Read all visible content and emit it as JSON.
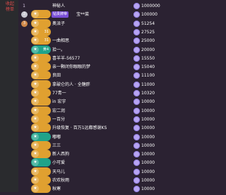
{
  "sidebar": {
    "tabs": [
      "收起",
      "榜单"
    ],
    "accent": "#e04b4b"
  },
  "rows": [
    {
      "rank": "1",
      "medal": "",
      "badge": "",
      "badge_color": "",
      "tag": "",
      "tag_color": "",
      "name": "神秘人",
      "score": "1000000"
    },
    {
      "rank": "",
      "medal": "2",
      "badge": "",
      "badge_color": "",
      "tag": "钻贵牌帝",
      "tag_color": "#7a4fd6",
      "name": "宝**菜",
      "score": "100000"
    },
    {
      "rank": "",
      "medal": "3",
      "badge": "",
      "badge_color": "",
      "tag": "",
      "tag_color": "",
      "name": "奥派子",
      "score": "51254"
    },
    {
      "rank": "",
      "medal": "",
      "badge": "31",
      "badge_color": "#e0a030",
      "tag": "",
      "tag_color": "",
      "name": "",
      "score": "27525"
    },
    {
      "rank": "",
      "medal": "",
      "badge": "31",
      "badge_color": "#e0a030",
      "tag": "",
      "tag_color": "",
      "name": "一曲相思",
      "score": "25000"
    },
    {
      "rank": "",
      "medal": "",
      "badge": "黄4",
      "badge_color": "#1fa38a",
      "tag": "",
      "tag_color": "",
      "name": "拾一。",
      "score": "20000"
    },
    {
      "rank": "",
      "medal": "",
      "badge": "",
      "badge_color": "#e0a030",
      "tag": "",
      "tag_color": "",
      "name": "喜羊羊-56577",
      "score": "15550"
    },
    {
      "rank": "",
      "medal": "",
      "badge": "",
      "badge_color": "#e0a030",
      "tag": "",
      "tag_color": "",
      "name": "亲一颗闭你眼眼的梦",
      "score": "15040"
    },
    {
      "rank": "",
      "medal": "",
      "badge": "",
      "badge_color": "#e0a030",
      "tag": "",
      "tag_color": "",
      "name": "良田",
      "score": "11100"
    },
    {
      "rank": "",
      "medal": "",
      "badge": "",
      "badge_color": "#e0a030",
      "tag": "",
      "tag_color": "",
      "name": "拿破仑的人 · 全糖胖",
      "score": "11000"
    },
    {
      "rank": "",
      "medal": "",
      "badge": "",
      "badge_color": "#e0a030",
      "tag": "",
      "tag_color": "",
      "name": "77青一",
      "score": "10320"
    },
    {
      "rank": "",
      "medal": "",
      "badge": "",
      "badge_color": "#e0a030",
      "tag": "",
      "tag_color": "",
      "name": "in 宏宇",
      "score": "10000"
    },
    {
      "rank": "",
      "medal": "",
      "badge": "",
      "badge_color": "#e0a030",
      "tag": "",
      "tag_color": "",
      "name": "宏二润",
      "score": "10000"
    },
    {
      "rank": "",
      "medal": "",
      "badge": "",
      "badge_color": "#e0a030",
      "tag": "",
      "tag_color": "",
      "name": "一百分",
      "score": "10000"
    },
    {
      "rank": "",
      "medal": "",
      "badge": "",
      "badge_color": "#e0a030",
      "tag": "",
      "tag_color": "",
      "name": "升级恢复 · 百万1远都感谢KS",
      "score": "10000"
    },
    {
      "rank": "",
      "medal": "",
      "badge": "",
      "badge_color": "#1fa38a",
      "tag": "",
      "tag_color": "",
      "name": "嘟嘟",
      "score": "10000"
    },
    {
      "rank": "",
      "medal": "",
      "badge": "",
      "badge_color": "#e0a030",
      "tag": "",
      "tag_color": "",
      "name": "三三",
      "score": "10000"
    },
    {
      "rank": "",
      "medal": "",
      "badge": "",
      "badge_color": "#e0a030",
      "tag": "",
      "tag_color": "",
      "name": "新人西狗",
      "score": "10000"
    },
    {
      "rank": "",
      "medal": "",
      "badge": "",
      "badge_color": "#1fa38a",
      "tag": "",
      "tag_color": "",
      "name": "小可爱",
      "score": "10000"
    },
    {
      "rank": "",
      "medal": "",
      "badge": "",
      "badge_color": "#e0a030",
      "tag": "",
      "tag_color": "",
      "name": "天马儿",
      "score": "10000"
    },
    {
      "rank": "",
      "medal": "",
      "badge": "",
      "badge_color": "#e0a030",
      "tag": "",
      "tag_color": "",
      "name": "农欢秋雨",
      "score": "10000"
    },
    {
      "rank": "",
      "medal": "",
      "badge": "",
      "badge_color": "#e0a030",
      "tag": "",
      "tag_color": "",
      "name": "秋寒",
      "score": "10000"
    }
  ],
  "medal_colors": {
    "2": "#c9c9d2",
    "3": "#d08a4a"
  },
  "coin_icon": "purple-coin-icon"
}
